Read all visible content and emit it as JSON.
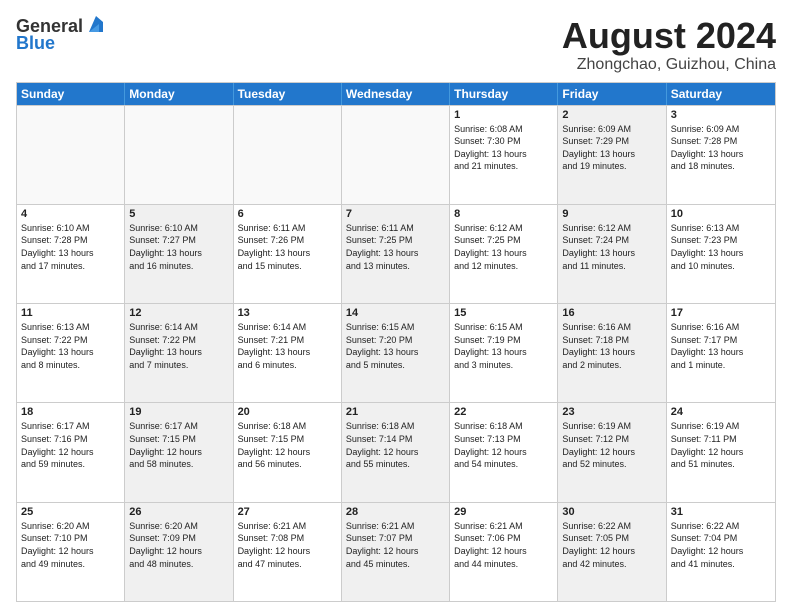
{
  "header": {
    "logo_line1": "General",
    "logo_line2": "Blue",
    "month": "August 2024",
    "location": "Zhongchao, Guizhou, China"
  },
  "weekdays": [
    "Sunday",
    "Monday",
    "Tuesday",
    "Wednesday",
    "Thursday",
    "Friday",
    "Saturday"
  ],
  "rows": [
    [
      {
        "day": "",
        "info": "",
        "shaded": false,
        "empty": true
      },
      {
        "day": "",
        "info": "",
        "shaded": false,
        "empty": true
      },
      {
        "day": "",
        "info": "",
        "shaded": false,
        "empty": true
      },
      {
        "day": "",
        "info": "",
        "shaded": false,
        "empty": true
      },
      {
        "day": "1",
        "info": "Sunrise: 6:08 AM\nSunset: 7:30 PM\nDaylight: 13 hours\nand 21 minutes.",
        "shaded": false,
        "empty": false
      },
      {
        "day": "2",
        "info": "Sunrise: 6:09 AM\nSunset: 7:29 PM\nDaylight: 13 hours\nand 19 minutes.",
        "shaded": true,
        "empty": false
      },
      {
        "day": "3",
        "info": "Sunrise: 6:09 AM\nSunset: 7:28 PM\nDaylight: 13 hours\nand 18 minutes.",
        "shaded": false,
        "empty": false
      }
    ],
    [
      {
        "day": "4",
        "info": "Sunrise: 6:10 AM\nSunset: 7:28 PM\nDaylight: 13 hours\nand 17 minutes.",
        "shaded": false,
        "empty": false
      },
      {
        "day": "5",
        "info": "Sunrise: 6:10 AM\nSunset: 7:27 PM\nDaylight: 13 hours\nand 16 minutes.",
        "shaded": true,
        "empty": false
      },
      {
        "day": "6",
        "info": "Sunrise: 6:11 AM\nSunset: 7:26 PM\nDaylight: 13 hours\nand 15 minutes.",
        "shaded": false,
        "empty": false
      },
      {
        "day": "7",
        "info": "Sunrise: 6:11 AM\nSunset: 7:25 PM\nDaylight: 13 hours\nand 13 minutes.",
        "shaded": true,
        "empty": false
      },
      {
        "day": "8",
        "info": "Sunrise: 6:12 AM\nSunset: 7:25 PM\nDaylight: 13 hours\nand 12 minutes.",
        "shaded": false,
        "empty": false
      },
      {
        "day": "9",
        "info": "Sunrise: 6:12 AM\nSunset: 7:24 PM\nDaylight: 13 hours\nand 11 minutes.",
        "shaded": true,
        "empty": false
      },
      {
        "day": "10",
        "info": "Sunrise: 6:13 AM\nSunset: 7:23 PM\nDaylight: 13 hours\nand 10 minutes.",
        "shaded": false,
        "empty": false
      }
    ],
    [
      {
        "day": "11",
        "info": "Sunrise: 6:13 AM\nSunset: 7:22 PM\nDaylight: 13 hours\nand 8 minutes.",
        "shaded": false,
        "empty": false
      },
      {
        "day": "12",
        "info": "Sunrise: 6:14 AM\nSunset: 7:22 PM\nDaylight: 13 hours\nand 7 minutes.",
        "shaded": true,
        "empty": false
      },
      {
        "day": "13",
        "info": "Sunrise: 6:14 AM\nSunset: 7:21 PM\nDaylight: 13 hours\nand 6 minutes.",
        "shaded": false,
        "empty": false
      },
      {
        "day": "14",
        "info": "Sunrise: 6:15 AM\nSunset: 7:20 PM\nDaylight: 13 hours\nand 5 minutes.",
        "shaded": true,
        "empty": false
      },
      {
        "day": "15",
        "info": "Sunrise: 6:15 AM\nSunset: 7:19 PM\nDaylight: 13 hours\nand 3 minutes.",
        "shaded": false,
        "empty": false
      },
      {
        "day": "16",
        "info": "Sunrise: 6:16 AM\nSunset: 7:18 PM\nDaylight: 13 hours\nand 2 minutes.",
        "shaded": true,
        "empty": false
      },
      {
        "day": "17",
        "info": "Sunrise: 6:16 AM\nSunset: 7:17 PM\nDaylight: 13 hours\nand 1 minute.",
        "shaded": false,
        "empty": false
      }
    ],
    [
      {
        "day": "18",
        "info": "Sunrise: 6:17 AM\nSunset: 7:16 PM\nDaylight: 12 hours\nand 59 minutes.",
        "shaded": false,
        "empty": false
      },
      {
        "day": "19",
        "info": "Sunrise: 6:17 AM\nSunset: 7:15 PM\nDaylight: 12 hours\nand 58 minutes.",
        "shaded": true,
        "empty": false
      },
      {
        "day": "20",
        "info": "Sunrise: 6:18 AM\nSunset: 7:15 PM\nDaylight: 12 hours\nand 56 minutes.",
        "shaded": false,
        "empty": false
      },
      {
        "day": "21",
        "info": "Sunrise: 6:18 AM\nSunset: 7:14 PM\nDaylight: 12 hours\nand 55 minutes.",
        "shaded": true,
        "empty": false
      },
      {
        "day": "22",
        "info": "Sunrise: 6:18 AM\nSunset: 7:13 PM\nDaylight: 12 hours\nand 54 minutes.",
        "shaded": false,
        "empty": false
      },
      {
        "day": "23",
        "info": "Sunrise: 6:19 AM\nSunset: 7:12 PM\nDaylight: 12 hours\nand 52 minutes.",
        "shaded": true,
        "empty": false
      },
      {
        "day": "24",
        "info": "Sunrise: 6:19 AM\nSunset: 7:11 PM\nDaylight: 12 hours\nand 51 minutes.",
        "shaded": false,
        "empty": false
      }
    ],
    [
      {
        "day": "25",
        "info": "Sunrise: 6:20 AM\nSunset: 7:10 PM\nDaylight: 12 hours\nand 49 minutes.",
        "shaded": false,
        "empty": false
      },
      {
        "day": "26",
        "info": "Sunrise: 6:20 AM\nSunset: 7:09 PM\nDaylight: 12 hours\nand 48 minutes.",
        "shaded": true,
        "empty": false
      },
      {
        "day": "27",
        "info": "Sunrise: 6:21 AM\nSunset: 7:08 PM\nDaylight: 12 hours\nand 47 minutes.",
        "shaded": false,
        "empty": false
      },
      {
        "day": "28",
        "info": "Sunrise: 6:21 AM\nSunset: 7:07 PM\nDaylight: 12 hours\nand 45 minutes.",
        "shaded": true,
        "empty": false
      },
      {
        "day": "29",
        "info": "Sunrise: 6:21 AM\nSunset: 7:06 PM\nDaylight: 12 hours\nand 44 minutes.",
        "shaded": false,
        "empty": false
      },
      {
        "day": "30",
        "info": "Sunrise: 6:22 AM\nSunset: 7:05 PM\nDaylight: 12 hours\nand 42 minutes.",
        "shaded": true,
        "empty": false
      },
      {
        "day": "31",
        "info": "Sunrise: 6:22 AM\nSunset: 7:04 PM\nDaylight: 12 hours\nand 41 minutes.",
        "shaded": false,
        "empty": false
      }
    ]
  ]
}
